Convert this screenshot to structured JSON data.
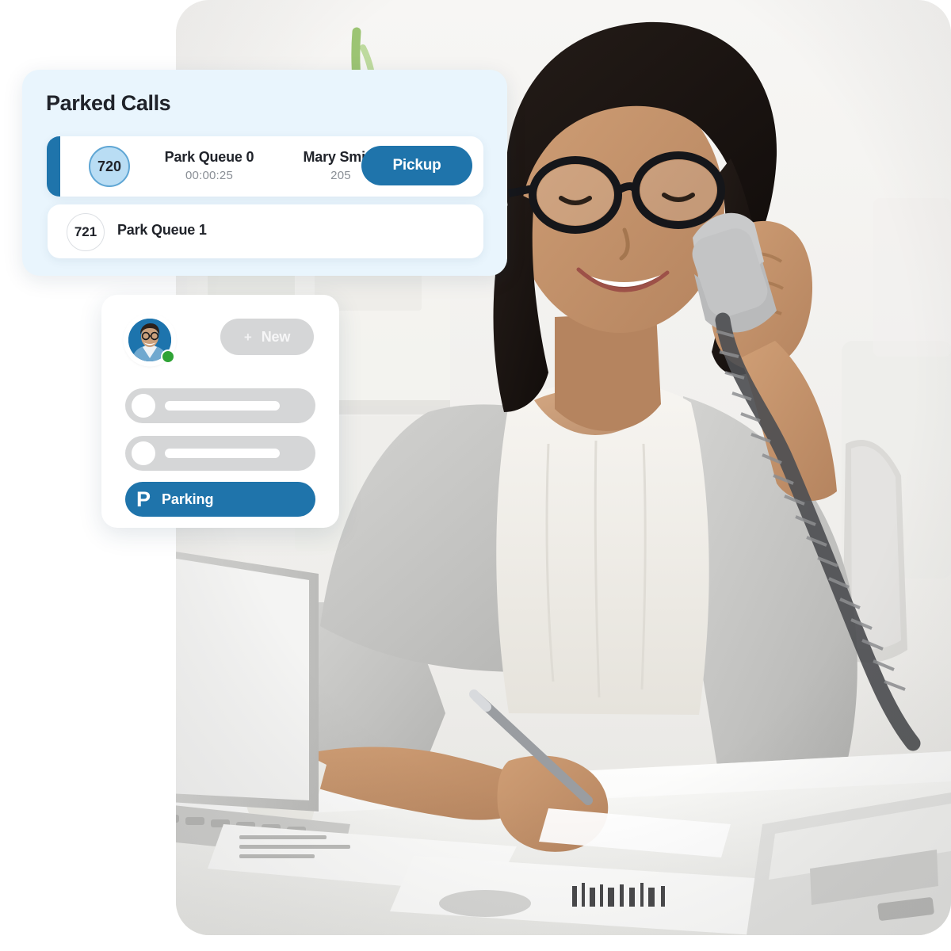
{
  "photo": {
    "alt_description": "Businesswoman with glasses smiling while talking on a desk phone handset at a white office desk with laptop and papers",
    "corner_radius_px": 42,
    "scene_colors": {
      "wall": "#f3f2f0",
      "blazer": "#c9c9c7",
      "blouse": "#f4f2ee",
      "hair": "#1c1715",
      "skin": "#c08f67",
      "desk": "#f7f7f5",
      "phone_cord": "#555558"
    }
  },
  "parked_calls_card": {
    "title": "Parked Calls",
    "background": "#e9f5fd",
    "accent_color": "#1f74ab",
    "rows": [
      {
        "extension": "720",
        "queue_label": "Park Queue 0",
        "timer": "00:00:25",
        "caller_name": "Mary Smith",
        "caller_extension": "205",
        "action_label": "Pickup",
        "active": true
      },
      {
        "extension": "721",
        "queue_label": "Park Queue 1",
        "timer": "",
        "caller_name": "",
        "caller_extension": "",
        "action_label": "",
        "active": false
      }
    ]
  },
  "softphone_card": {
    "avatar": {
      "icon": "user-avatar-photo",
      "presence": "online",
      "presence_color": "#2fa336"
    },
    "new_button": {
      "plus": "+",
      "label": "New",
      "color": "#d5d6d7"
    },
    "placeholder_rows": 2,
    "parking_button": {
      "glyph": "P",
      "label": "Parking",
      "color": "#1f74ab"
    }
  }
}
